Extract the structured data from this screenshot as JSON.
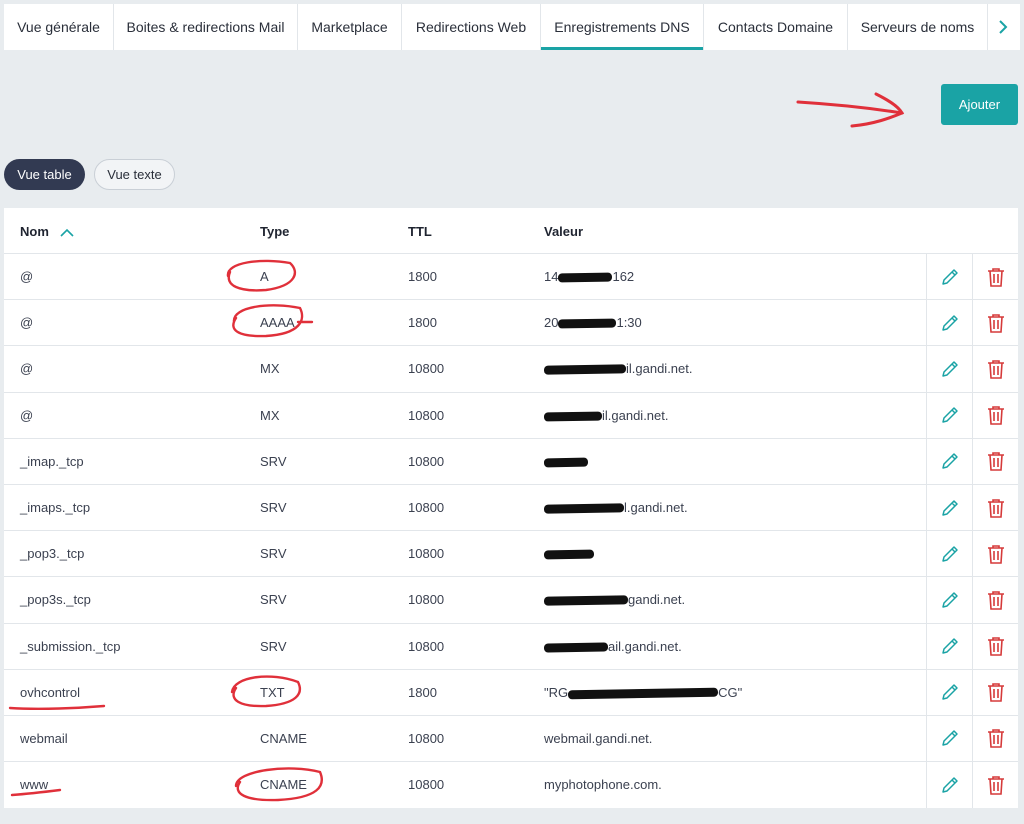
{
  "tabs": [
    {
      "label": "Vue générale"
    },
    {
      "label": "Boites & redirections Mail"
    },
    {
      "label": "Marketplace"
    },
    {
      "label": "Redirections Web"
    },
    {
      "label": "Enregistrements DNS"
    },
    {
      "label": "Contacts Domaine"
    },
    {
      "label": "Serveurs de noms"
    }
  ],
  "active_tab": "Enregistrements DNS",
  "add_button": {
    "label": "Ajouter"
  },
  "view_toggle": {
    "table": "Vue table",
    "text": "Vue texte"
  },
  "columns": {
    "name": "Nom",
    "type": "Type",
    "ttl": "TTL",
    "value": "Valeur"
  },
  "records": [
    {
      "name": "@",
      "type": "A",
      "ttl": "1800",
      "value_pre": "14",
      "value_post": "162"
    },
    {
      "name": "@",
      "type": "AAAA",
      "ttl": "1800",
      "value_pre": "20",
      "value_post": "1:30"
    },
    {
      "name": "@",
      "type": "MX",
      "ttl": "10800",
      "value_pre": "",
      "value_post": "il.gandi.net."
    },
    {
      "name": "@",
      "type": "MX",
      "ttl": "10800",
      "value_pre": "",
      "value_post": "il.gandi.net."
    },
    {
      "name": "_imap._tcp",
      "type": "SRV",
      "ttl": "10800",
      "value_pre": "",
      "value_post": ""
    },
    {
      "name": "_imaps._tcp",
      "type": "SRV",
      "ttl": "10800",
      "value_pre": "",
      "value_post": "l.gandi.net."
    },
    {
      "name": "_pop3._tcp",
      "type": "SRV",
      "ttl": "10800",
      "value_pre": "",
      "value_post": ""
    },
    {
      "name": "_pop3s._tcp",
      "type": "SRV",
      "ttl": "10800",
      "value_pre": "",
      "value_post": "gandi.net."
    },
    {
      "name": "_submission._tcp",
      "type": "SRV",
      "ttl": "10800",
      "value_pre": "",
      "value_post": "ail.gandi.net."
    },
    {
      "name": "ovhcontrol",
      "type": "TXT",
      "ttl": "1800",
      "value_pre": "\"RG",
      "value_post": "CG\""
    },
    {
      "name": "webmail",
      "type": "CNAME",
      "ttl": "10800",
      "value_pre": "webmail.gandi.net.",
      "value_post": ""
    },
    {
      "name": "www",
      "type": "CNAME",
      "ttl": "10800",
      "value_pre": "myphotophone.com.",
      "value_post": ""
    }
  ],
  "icons": {
    "sort": "chevron-up-icon",
    "next": "chevron-right-icon",
    "edit": "pencil-icon",
    "delete": "trash-icon"
  },
  "colors": {
    "accent": "#1aa3a5",
    "active_pill": "#323a52",
    "delete": "#d63a3a",
    "annotation": "#e0303a"
  }
}
